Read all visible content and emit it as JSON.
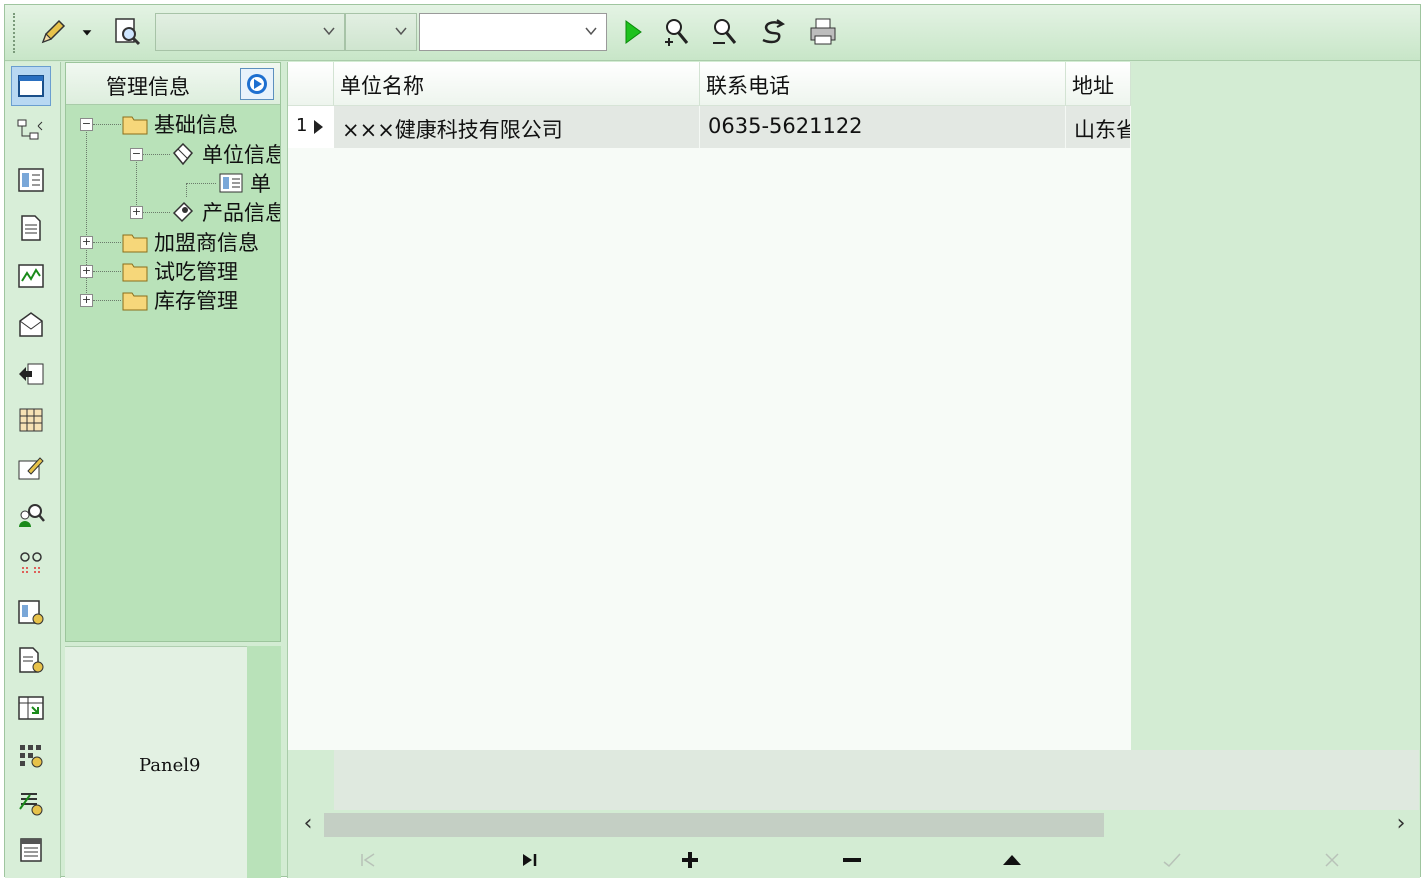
{
  "toolbar": {
    "combo1_value": "",
    "combo2_value": "",
    "combo3_value": "",
    "icons": [
      "pencil-icon",
      "dropdown-arrow-icon",
      "preview-icon",
      "run-icon",
      "find-icon",
      "find-next-icon",
      "replace-icon",
      "print-icon"
    ]
  },
  "sidebar_icons": [
    "window-icon",
    "network-icon",
    "form-icon",
    "document-icon",
    "chart-icon",
    "mail-icon",
    "export-icon",
    "grid-icon",
    "edit-form-icon",
    "user-search-icon",
    "link-icon",
    "report-icon",
    "report2-icon",
    "import-icon",
    "matrix-icon",
    "settings-icon",
    "list-icon"
  ],
  "tree": {
    "header": "管理信息",
    "nodes": [
      {
        "label": "基础信息",
        "icon": "folder-icon"
      },
      {
        "label": "单位信息",
        "icon": "diamond-icon"
      },
      {
        "label": "单",
        "icon": "form-icon"
      },
      {
        "label": "产品信息",
        "icon": "product-icon"
      },
      {
        "label": "加盟商信息",
        "icon": "folder-icon"
      },
      {
        "label": "试吃管理",
        "icon": "folder-icon"
      },
      {
        "label": "库存管理",
        "icon": "folder-icon"
      }
    ]
  },
  "panel9": {
    "label": "Panel9"
  },
  "grid": {
    "columns": [
      "单位名称",
      "联系电话",
      "地址"
    ],
    "rows": [
      {
        "index": "1",
        "cells": [
          "×××健康科技有限公司",
          "0635-5621122",
          "山东省"
        ]
      }
    ]
  },
  "navigator": [
    "first-icon",
    "last-icon",
    "insert-icon",
    "delete-icon",
    "up-icon",
    "post-icon",
    "cancel-icon"
  ],
  "colors": {
    "panel_green": "#b9e2b9",
    "toolbar_green": "#d3ecd3",
    "run_green": "#1ec21e"
  }
}
